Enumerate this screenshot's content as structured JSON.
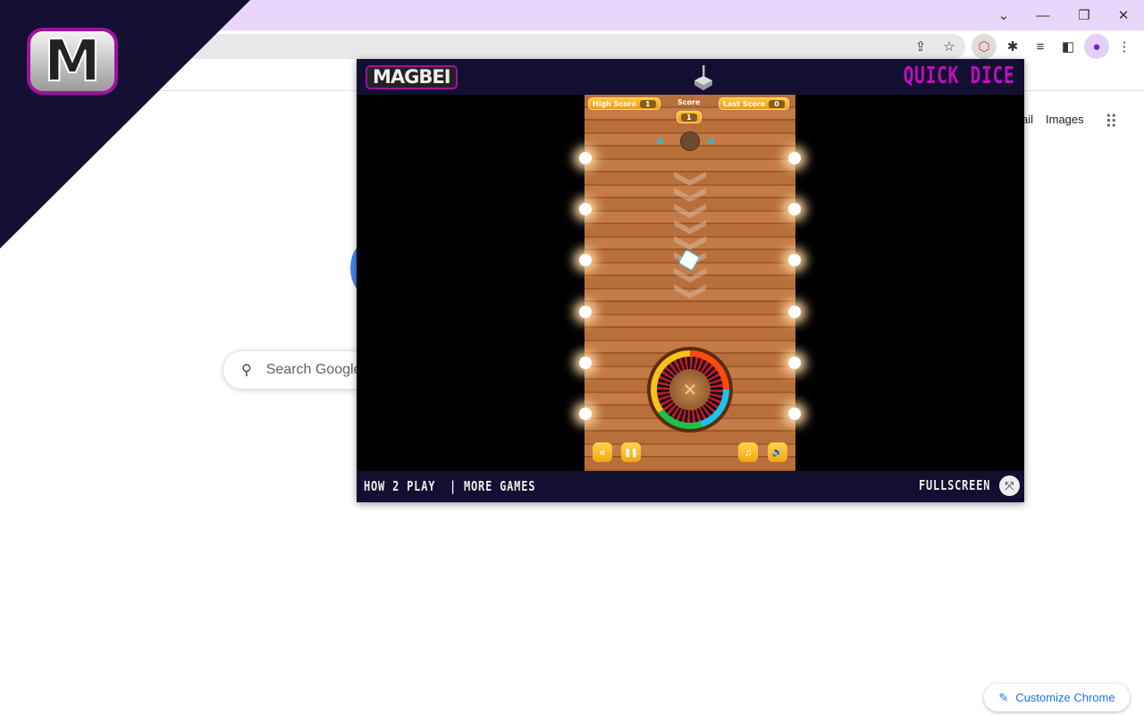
{
  "browser": {
    "window_controls": {
      "tab_search": "⌄",
      "minimize": "—",
      "restore": "❐",
      "close": "✕"
    },
    "toolbar_icons": [
      "share-icon",
      "star-icon",
      "dice-extension-icon",
      "puzzle-extensions-icon",
      "media-queue-icon",
      "side-panel-icon",
      "profile-icon",
      "menu-icon"
    ]
  },
  "overlay": {
    "logo_letter": "M"
  },
  "google": {
    "gmail_link": "ail",
    "images_link": "Images",
    "search_placeholder": "Search Google",
    "customize_label": "Customize Chrome",
    "accent": "#1a73e8"
  },
  "popup": {
    "brand": "MAGBEI",
    "title": "QUICK DICE",
    "title_color": "#c00fc0",
    "footer": {
      "how_to_play": "HOW 2 PLAY",
      "divider": "|",
      "more_games": "MORE GAMES",
      "fullscreen": "FULLSCREEN"
    },
    "game": {
      "high_score_label": "High Score",
      "high_score": "1",
      "score_label": "Score",
      "score": "1",
      "last_score_label": "Last Score",
      "last_score": "0",
      "buttons": {
        "back": "«",
        "pause": "❚❚",
        "music": "♫",
        "sound": "🔊"
      }
    }
  }
}
